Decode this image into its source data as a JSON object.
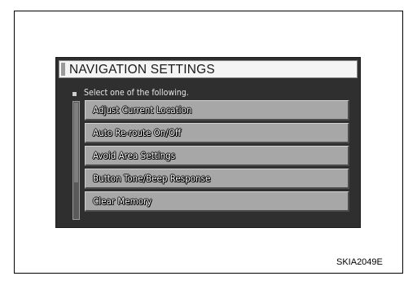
{
  "screen": {
    "title": "NAVIGATION SETTINGS",
    "prompt": "Select one of the following.",
    "menu_items": [
      {
        "label": "Adjust Current Location"
      },
      {
        "label": "Auto Re-route On/Off"
      },
      {
        "label": "Avoid Area Settings"
      },
      {
        "label": "Button Tone/Beep Response"
      },
      {
        "label": "Clear Memory"
      }
    ]
  },
  "figure_id": "SKIA2049E"
}
